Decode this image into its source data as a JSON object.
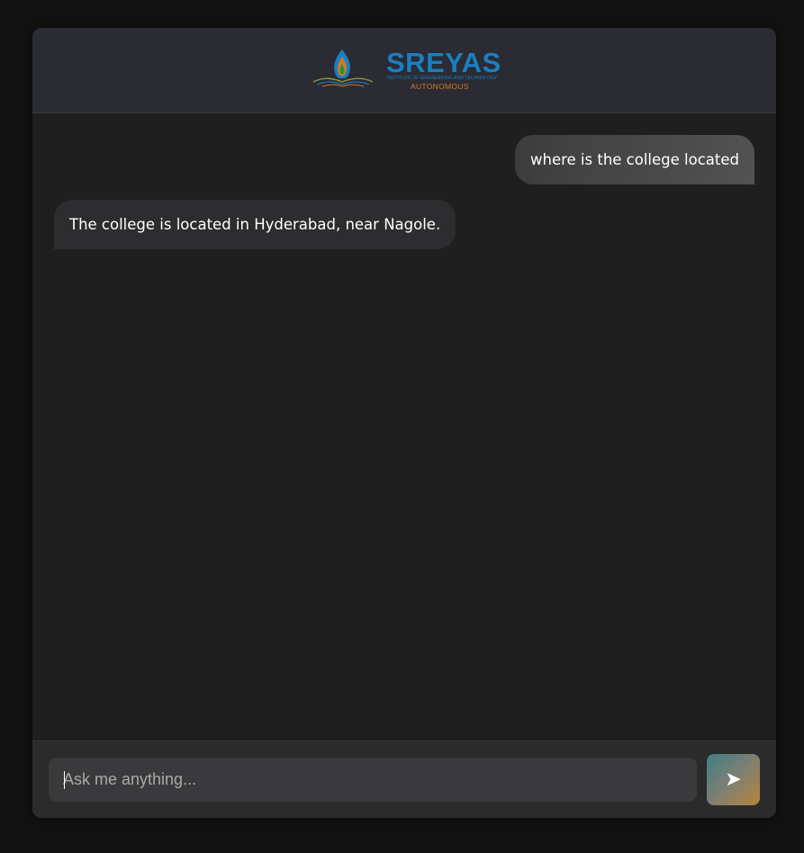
{
  "header": {
    "logo": {
      "name": "SREYAS",
      "subtitle": "INSTITUTE OF ENGINEERING AND TECHNOLOGY",
      "tag": "AUTONOMOUS"
    }
  },
  "messages": [
    {
      "role": "user",
      "text": "where is the college located"
    },
    {
      "role": "bot",
      "text": "The college is located in Hyderabad, near Nagole."
    }
  ],
  "composer": {
    "placeholder": "Ask me anything...",
    "value": "",
    "send_icon": "send-arrow-icon",
    "send_glyph": "➤"
  },
  "colors": {
    "page_bg": "#121212",
    "window_bg": "#1f1f1f",
    "header_bg": "#2b2b34",
    "brand_blue": "#1a7fc1",
    "brand_orange": "#d07a28"
  }
}
